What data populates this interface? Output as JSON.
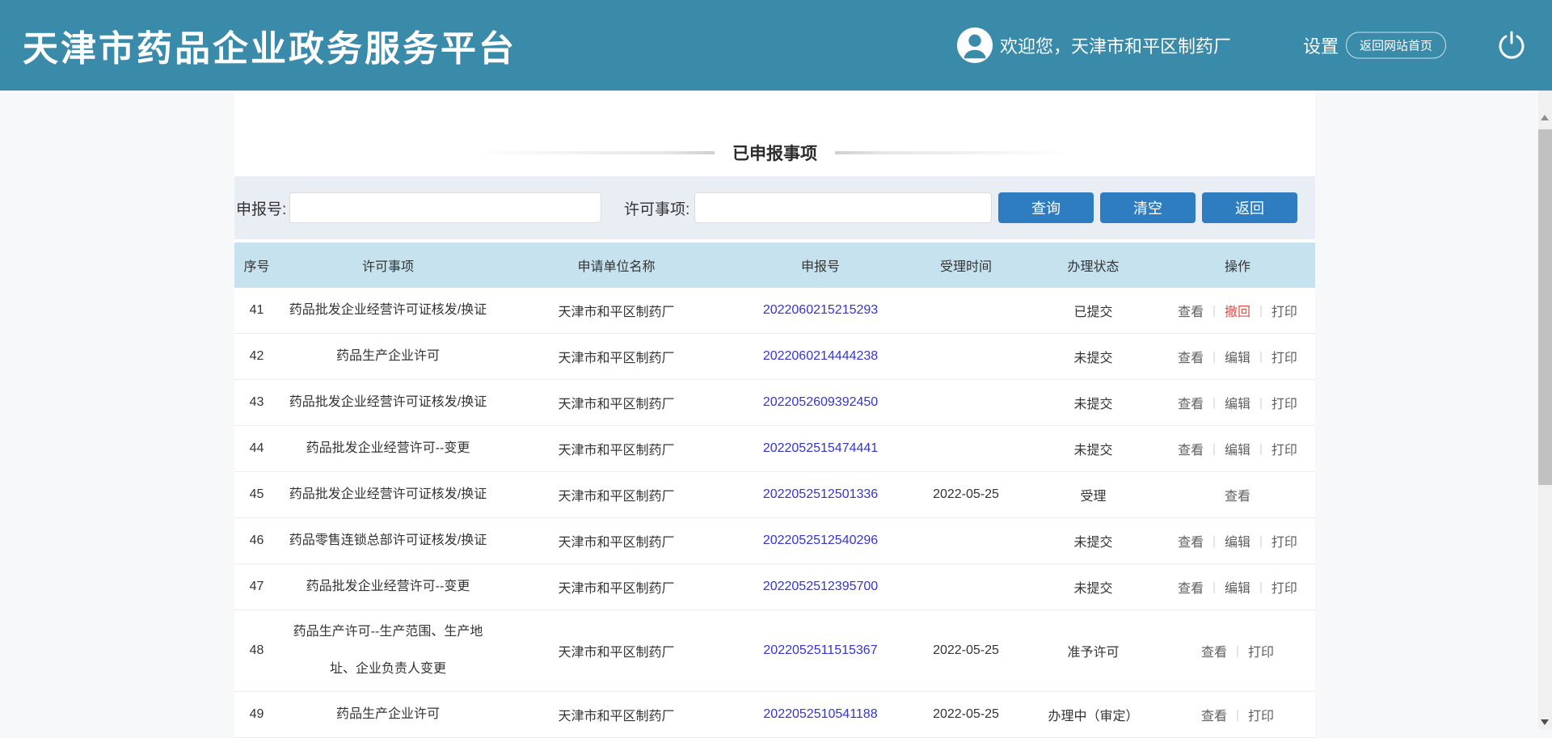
{
  "header": {
    "title": "天津市药品企业政务服务平台",
    "welcome": "欢迎您，天津市和平区制药厂",
    "settings_label": "设置",
    "home_button": "返回网站首页"
  },
  "page": {
    "section_title": "已申报事项"
  },
  "search": {
    "declare_no_label": "申报号:",
    "declare_no_value": "",
    "license_item_label": "许可事项:",
    "license_item_value": "",
    "buttons": {
      "query": "查询",
      "clear": "清空",
      "back": "返回"
    }
  },
  "table": {
    "columns": [
      "序号",
      "许可事项",
      "申请单位名称",
      "申报号",
      "受理时间",
      "办理状态",
      "操作"
    ],
    "rows": [
      {
        "no": "41",
        "item": "药品批发企业经营许可证核发/换证",
        "company": "天津市和平区制药厂",
        "declare_no": "2022060215215293",
        "accept_time": "",
        "status": "已提交",
        "actions": [
          {
            "label": "查看",
            "danger": false
          },
          {
            "label": "撤回",
            "danger": true
          },
          {
            "label": "打印",
            "danger": false
          }
        ]
      },
      {
        "no": "42",
        "item": "药品生产企业许可",
        "company": "天津市和平区制药厂",
        "declare_no": "2022060214444238",
        "accept_time": "",
        "status": "未提交",
        "actions": [
          {
            "label": "查看",
            "danger": false
          },
          {
            "label": "编辑",
            "danger": false
          },
          {
            "label": "打印",
            "danger": false
          }
        ]
      },
      {
        "no": "43",
        "item": "药品批发企业经营许可证核发/换证",
        "company": "天津市和平区制药厂",
        "declare_no": "2022052609392450",
        "accept_time": "",
        "status": "未提交",
        "actions": [
          {
            "label": "查看",
            "danger": false
          },
          {
            "label": "编辑",
            "danger": false
          },
          {
            "label": "打印",
            "danger": false
          }
        ]
      },
      {
        "no": "44",
        "item": "药品批发企业经营许可--变更",
        "company": "天津市和平区制药厂",
        "declare_no": "2022052515474441",
        "accept_time": "",
        "status": "未提交",
        "actions": [
          {
            "label": "查看",
            "danger": false
          },
          {
            "label": "编辑",
            "danger": false
          },
          {
            "label": "打印",
            "danger": false
          }
        ]
      },
      {
        "no": "45",
        "item": "药品批发企业经营许可证核发/换证",
        "company": "天津市和平区制药厂",
        "declare_no": "2022052512501336",
        "accept_time": "2022-05-25",
        "status": "受理",
        "actions": [
          {
            "label": "查看",
            "danger": false
          }
        ]
      },
      {
        "no": "46",
        "item": "药品零售连锁总部许可证核发/换证",
        "company": "天津市和平区制药厂",
        "declare_no": "2022052512540296",
        "accept_time": "",
        "status": "未提交",
        "actions": [
          {
            "label": "查看",
            "danger": false
          },
          {
            "label": "编辑",
            "danger": false
          },
          {
            "label": "打印",
            "danger": false
          }
        ]
      },
      {
        "no": "47",
        "item": "药品批发企业经营许可--变更",
        "company": "天津市和平区制药厂",
        "declare_no": "2022052512395700",
        "accept_time": "",
        "status": "未提交",
        "actions": [
          {
            "label": "查看",
            "danger": false
          },
          {
            "label": "编辑",
            "danger": false
          },
          {
            "label": "打印",
            "danger": false
          }
        ]
      },
      {
        "no": "48",
        "item": "药品生产许可--生产范围、生产地址、企业负责人变更",
        "company": "天津市和平区制药厂",
        "declare_no": "2022052511515367",
        "accept_time": "2022-05-25",
        "status": "准予许可",
        "actions": [
          {
            "label": "查看",
            "danger": false
          },
          {
            "label": "打印",
            "danger": false
          }
        ]
      },
      {
        "no": "49",
        "item": "药品生产企业许可",
        "company": "天津市和平区制药厂",
        "declare_no": "2022052510541188",
        "accept_time": "2022-05-25",
        "status": "办理中（审定）",
        "actions": [
          {
            "label": "查看",
            "danger": false
          },
          {
            "label": "打印",
            "danger": false
          }
        ]
      }
    ]
  },
  "colors": {
    "header_teal": "#3a8ba9",
    "button_blue": "#2e7dc1",
    "link_blue": "#3434d8",
    "danger_red": "#e0504a",
    "table_header_bg": "#c6e2ef",
    "search_band_bg": "#e9eef5"
  }
}
